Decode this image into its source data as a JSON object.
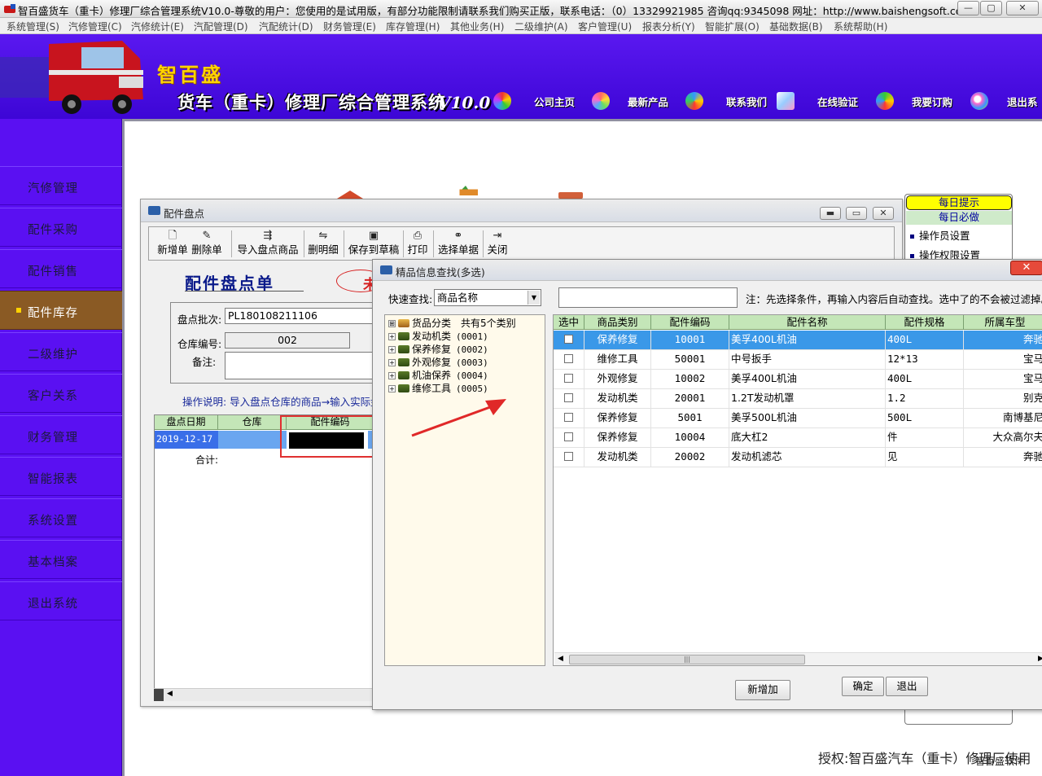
{
  "titlebar": {
    "title": "智百盛货车（重卡）修理厂综合管理系统V10.0-尊敬的用户：您使用的是试用版，有部分功能限制请联系我们购买正版，联系电话：（0）13329921985  咨询qq:9345098   网址：http://www.baishengsoft.com",
    "min": "—",
    "max": "▢",
    "close": "✕"
  },
  "menu": [
    "系统管理(S)",
    "汽修管理(C)",
    "汽修统计(E)",
    "汽配管理(D)",
    "汽配统计(D)",
    "财务管理(E)",
    "库存管理(H)",
    "其他业务(H)",
    "二级维护(A)",
    "客户管理(U)",
    "报表分析(Y)",
    "智能扩展(O)",
    "基础数据(B)",
    "系统帮助(H)"
  ],
  "banner": {
    "brand": "智百盛",
    "product": "货车（重卡）修理厂综合管理系统",
    "version": "V10.0",
    "links": [
      "公司主页",
      "最新产品",
      "联系我们",
      "在线验证",
      "我要订购",
      "退出系"
    ]
  },
  "sidebar": [
    {
      "label": "汽修管理"
    },
    {
      "label": "配件采购"
    },
    {
      "label": "配件销售"
    },
    {
      "label": "配件库存",
      "active": true
    },
    {
      "label": "二级维护"
    },
    {
      "label": "客户关系"
    },
    {
      "label": "财务管理"
    },
    {
      "label": "智能报表"
    },
    {
      "label": "系统设置"
    },
    {
      "label": "基本档案"
    },
    {
      "label": "退出系统"
    }
  ],
  "tips": {
    "header": "每日提示",
    "subheader": "每日必做",
    "items": [
      "操作员设置",
      "操作权限设置"
    ]
  },
  "stocktake_window": {
    "title": "配件盘点",
    "toolbar": [
      {
        "label": "新增单",
        "icon": "new-doc-icon"
      },
      {
        "label": "删除单",
        "icon": "delete-doc-icon"
      },
      {
        "label": "导入盘点商品",
        "icon": "import-icon"
      },
      {
        "label": "删明细",
        "icon": "delete-detail-icon"
      },
      {
        "label": "保存到草稿",
        "icon": "save-icon"
      },
      {
        "label": "打印",
        "icon": "print-icon"
      },
      {
        "label": "选择单据",
        "icon": "binoculars-icon"
      },
      {
        "label": "关闭",
        "icon": "exit-icon"
      }
    ],
    "form_title": "配件盘点单",
    "stamp": "未",
    "batch_label": "盘点批次:",
    "batch_value": "PL180108211106",
    "warehouse_label": "仓库编号:",
    "warehouse_value": "002",
    "remark_label": "备注:",
    "remark_value": "",
    "op_note": "操作说明: 导入盘点仓库的商品→输入实际盘",
    "grid": {
      "headers": [
        "盘点日期",
        "仓库",
        "配件编码"
      ],
      "row": [
        "2019-12-17",
        "",
        ""
      ],
      "total_label": "合计:"
    }
  },
  "search_window": {
    "title": "精品信息查找(多选)",
    "close": "✕",
    "quick_label": "快速查找:",
    "quick_select": "商品名称",
    "quick_input": "",
    "note": "注：先选择条件，再输入内容后自动查找。选中了的不会被过滤掉。",
    "tree": {
      "root": "货品分类",
      "root_count": "共有5个类别",
      "children": [
        {
          "name": "发动机类",
          "code": "(0001)"
        },
        {
          "name": "保养修复",
          "code": "(0002)"
        },
        {
          "name": "外观修复",
          "code": "(0003)"
        },
        {
          "name": "机油保养",
          "code": "(0004)"
        },
        {
          "name": "维修工具",
          "code": "(0005)"
        }
      ]
    },
    "columns": [
      "选中",
      "商品类别",
      "配件编码",
      "配件名称",
      "配件规格",
      "所属车型"
    ],
    "rows": [
      {
        "category": "保养修复",
        "code": "10001",
        "name": "美孚400L机油",
        "spec": "400L",
        "model": "奔驰",
        "selected": true
      },
      {
        "category": "维修工具",
        "code": "50001",
        "name": "中号扳手",
        "spec": "12*13",
        "model": "宝马"
      },
      {
        "category": "外观修复",
        "code": "10002",
        "name": "美孚400L机油",
        "spec": "400L",
        "model": "宝马"
      },
      {
        "category": "发动机类",
        "code": "20001",
        "name": "1.2T发动机罩",
        "spec": "1.2",
        "model": "别克"
      },
      {
        "category": "保养修复",
        "code": "5001",
        "name": "美孚500L机油",
        "spec": "500L",
        "model": "南博基尼"
      },
      {
        "category": "保养修复",
        "code": "10004",
        "name": "底大杠2",
        "spec": "件",
        "model": "大众高尔夫"
      },
      {
        "category": "发动机类",
        "code": "20002",
        "name": "发动机滤芯",
        "spec": "见",
        "model": "奔驰"
      }
    ],
    "scroll_thumb": "|||",
    "buttons": {
      "add": "新增加",
      "ok": "确定",
      "exit": "退出"
    }
  },
  "footer": {
    "license": "授权:智百盛汽车（重卡）修理厂使用",
    "brand_small": "智百盛软件"
  }
}
